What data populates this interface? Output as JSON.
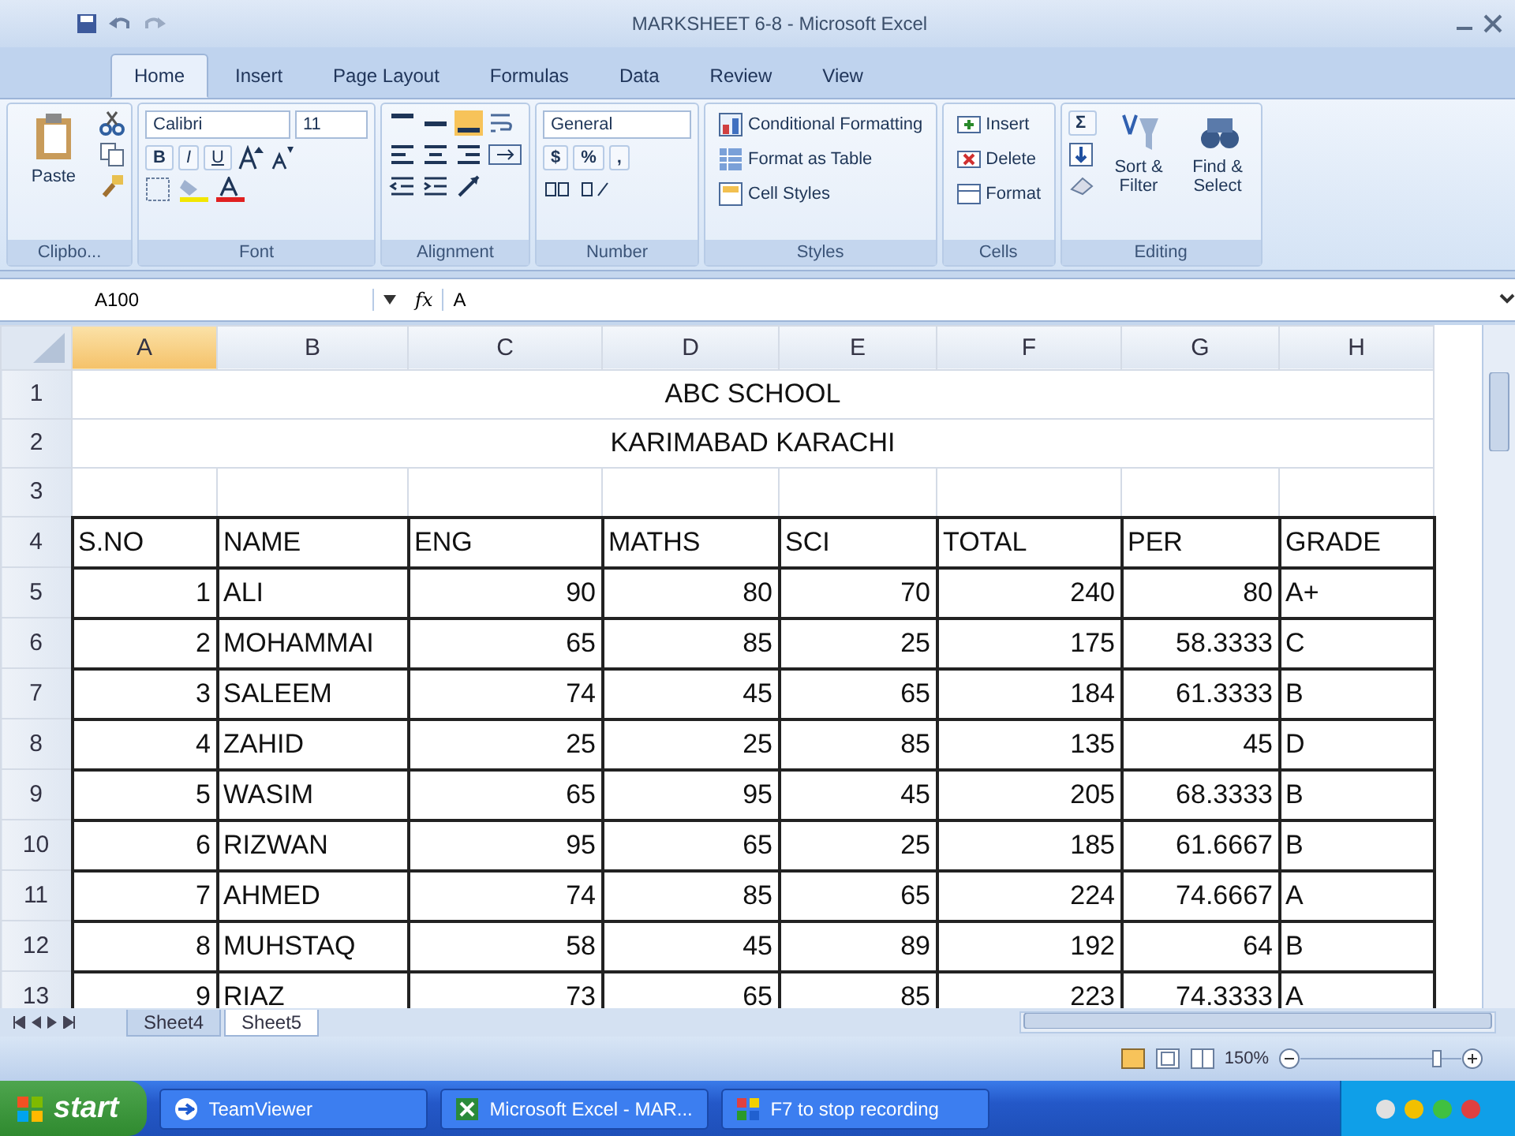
{
  "window": {
    "title": "MARKSHEET 6-8 - Microsoft Excel"
  },
  "ribbon_tabs": [
    {
      "label": "Home",
      "selected": true
    },
    {
      "label": "Insert",
      "selected": false
    },
    {
      "label": "Page Layout",
      "selected": false
    },
    {
      "label": "Formulas",
      "selected": false
    },
    {
      "label": "Data",
      "selected": false
    },
    {
      "label": "Review",
      "selected": false
    },
    {
      "label": "View",
      "selected": false
    }
  ],
  "ribbon_groups": [
    {
      "kind": "clipboard",
      "label": "Clipbo...",
      "paste": "Paste"
    },
    {
      "kind": "font",
      "label": "Font",
      "font_name": "Calibri",
      "font_size": "11",
      "bold": "B",
      "italic": "I",
      "underline": "U"
    },
    {
      "kind": "alignment",
      "label": "Alignment"
    },
    {
      "kind": "number",
      "label": "Number",
      "format": "General",
      "currency": "$",
      "percent": "%",
      "comma": ","
    },
    {
      "kind": "styles",
      "label": "Styles",
      "items": [
        "Conditional Formatting",
        "Format as Table",
        "Cell Styles"
      ]
    },
    {
      "kind": "cells",
      "label": "Cells",
      "items": [
        "Insert",
        "Delete",
        "Format"
      ]
    },
    {
      "kind": "editing",
      "label": "Editing",
      "sigma": "Σ",
      "items": [
        "Sort & Filter",
        "Find & Select"
      ]
    }
  ],
  "formula_bar": {
    "name_box": "A100",
    "function_label": "fx",
    "value": "A"
  },
  "sheet": {
    "columns": [
      {
        "label": "A",
        "selected": true
      },
      {
        "label": "B",
        "selected": false
      },
      {
        "label": "C",
        "selected": false
      },
      {
        "label": "D",
        "selected": false
      },
      {
        "label": "E",
        "selected": false
      },
      {
        "label": "F",
        "selected": false
      },
      {
        "label": "G",
        "selected": false
      },
      {
        "label": "H",
        "selected": false
      }
    ],
    "rows": [
      {
        "number": "1",
        "kind": "title",
        "text": "ABC SCHOOL"
      },
      {
        "number": "2",
        "kind": "title",
        "text": "KARIMABAD KARACHI"
      },
      {
        "number": "3",
        "kind": "blank"
      },
      {
        "number": "4",
        "kind": "header",
        "cells": [
          "S.NO",
          "NAME",
          "ENG",
          "MATHS",
          "SCI",
          "TOTAL",
          "PER",
          "GRADE"
        ]
      },
      {
        "number": "5",
        "kind": "data",
        "cells": [
          "1",
          "ALI",
          "90",
          "80",
          "70",
          "240",
          "80",
          "A+"
        ]
      },
      {
        "number": "6",
        "kind": "data",
        "cells": [
          "2",
          "MOHAMMAI",
          "65",
          "85",
          "25",
          "175",
          "58.3333",
          "C"
        ]
      },
      {
        "number": "7",
        "kind": "data",
        "cells": [
          "3",
          "SALEEM",
          "74",
          "45",
          "65",
          "184",
          "61.3333",
          "B"
        ]
      },
      {
        "number": "8",
        "kind": "data",
        "cells": [
          "4",
          "ZAHID",
          "25",
          "25",
          "85",
          "135",
          "45",
          "D"
        ]
      },
      {
        "number": "9",
        "kind": "data",
        "cells": [
          "5",
          "WASIM",
          "65",
          "95",
          "45",
          "205",
          "68.3333",
          "B"
        ]
      },
      {
        "number": "10",
        "kind": "data",
        "cells": [
          "6",
          "RIZWAN",
          "95",
          "65",
          "25",
          "185",
          "61.6667",
          "B"
        ]
      },
      {
        "number": "11",
        "kind": "data",
        "cells": [
          "7",
          "AHMED",
          "74",
          "85",
          "65",
          "224",
          "74.6667",
          "A"
        ]
      },
      {
        "number": "12",
        "kind": "data",
        "cells": [
          "8",
          "MUHSTAQ",
          "58",
          "45",
          "89",
          "192",
          "64",
          "B"
        ]
      },
      {
        "number": "13",
        "kind": "data",
        "cells": [
          "9",
          "RIAZ",
          "73",
          "65",
          "85",
          "223",
          "74.3333",
          "A"
        ]
      }
    ]
  },
  "sheet_tabs": [
    {
      "label": "Sheet4",
      "selected": false
    },
    {
      "label": "Sheet5",
      "selected": true
    }
  ],
  "status_bar": {
    "zoom": "150%"
  },
  "taskbar": {
    "start": "start",
    "items": [
      "TeamViewer",
      "Microsoft Excel - MAR...",
      "F7 to stop recording"
    ]
  }
}
